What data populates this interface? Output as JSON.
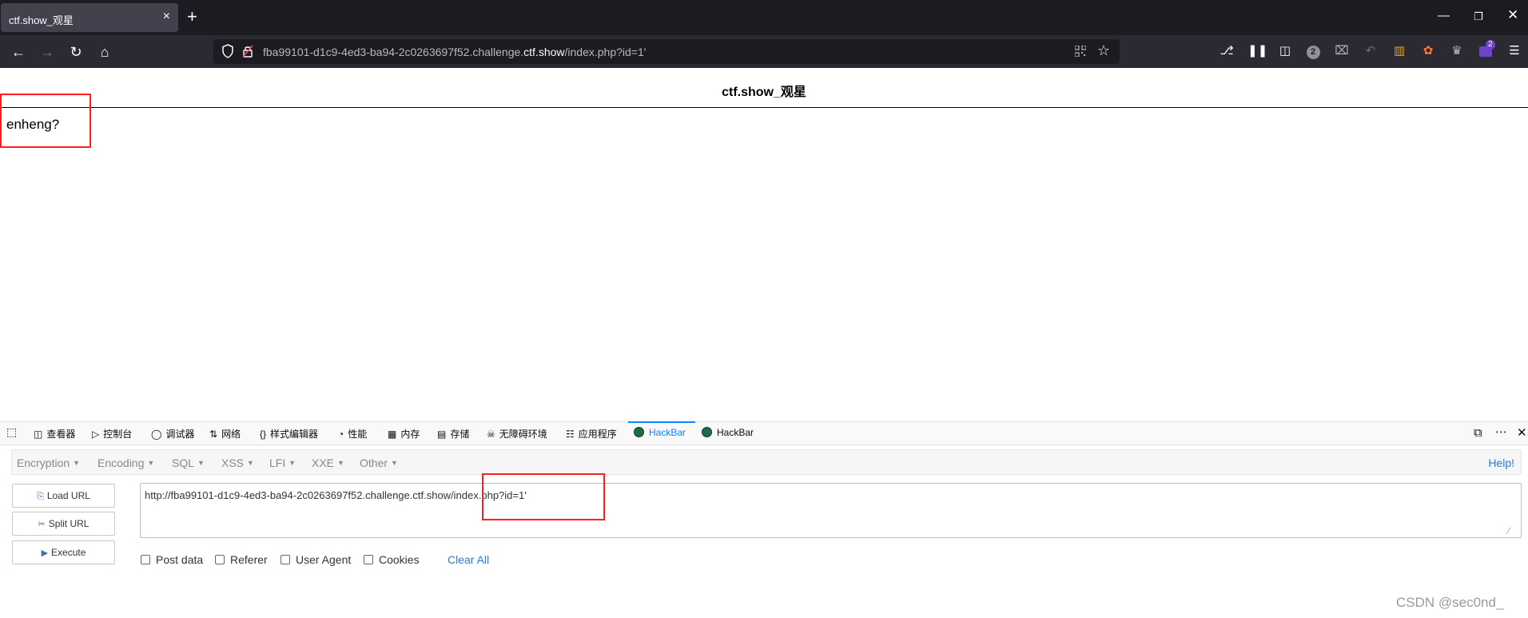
{
  "browser": {
    "tab_title": "ctf.show_观星",
    "tab_close": "×",
    "new_tab": "+",
    "url_prefix": "fba99101-d1c9-4ed3-ba94-2c0263697f52.challenge.",
    "url_host": "ctf.show",
    "url_path": "/index.php?id=1'",
    "extension_badge": "2",
    "notification_badge": "2"
  },
  "page": {
    "heading": "ctf.show_观星",
    "body_text": "enheng?"
  },
  "devtools": {
    "tabs": [
      {
        "label": "查看器",
        "icon": "inspector-icon"
      },
      {
        "label": "控制台",
        "icon": "console-icon"
      },
      {
        "label": "调试器",
        "icon": "debugger-icon"
      },
      {
        "label": "网络",
        "icon": "network-icon"
      },
      {
        "label": "样式编辑器",
        "icon": "style-editor-icon"
      },
      {
        "label": "性能",
        "icon": "performance-icon"
      },
      {
        "label": "内存",
        "icon": "memory-icon"
      },
      {
        "label": "存储",
        "icon": "storage-icon"
      },
      {
        "label": "无障碍环境",
        "icon": "accessibility-icon"
      },
      {
        "label": "应用程序",
        "icon": "application-icon"
      },
      {
        "label": "HackBar",
        "icon": "hackbar-icon"
      },
      {
        "label": "HackBar",
        "icon": "hackbar-icon"
      }
    ],
    "active_tab_index": 10
  },
  "hackbar": {
    "menu": [
      "Encryption",
      "Encoding",
      "SQL",
      "XSS",
      "LFI",
      "XXE",
      "Other"
    ],
    "help": "Help!",
    "buttons": {
      "load_url": "Load URL",
      "split_url": "Split URL",
      "execute": "Execute"
    },
    "url_value": "http://fba99101-d1c9-4ed3-ba94-2c0263697f52.challenge.ctf.show/index.php?id=1'",
    "options": {
      "post_data": "Post data",
      "referer": "Referer",
      "user_agent": "User Agent",
      "cookies": "Cookies"
    },
    "clear_all": "Clear All"
  },
  "watermark": "CSDN @sec0nd_",
  "colors": {
    "highlight": "#ff1e1e",
    "tabbar_bg": "#1c1b22",
    "navbar_bg": "#2b2a33",
    "hackbar_accent": "#0a84ff"
  }
}
